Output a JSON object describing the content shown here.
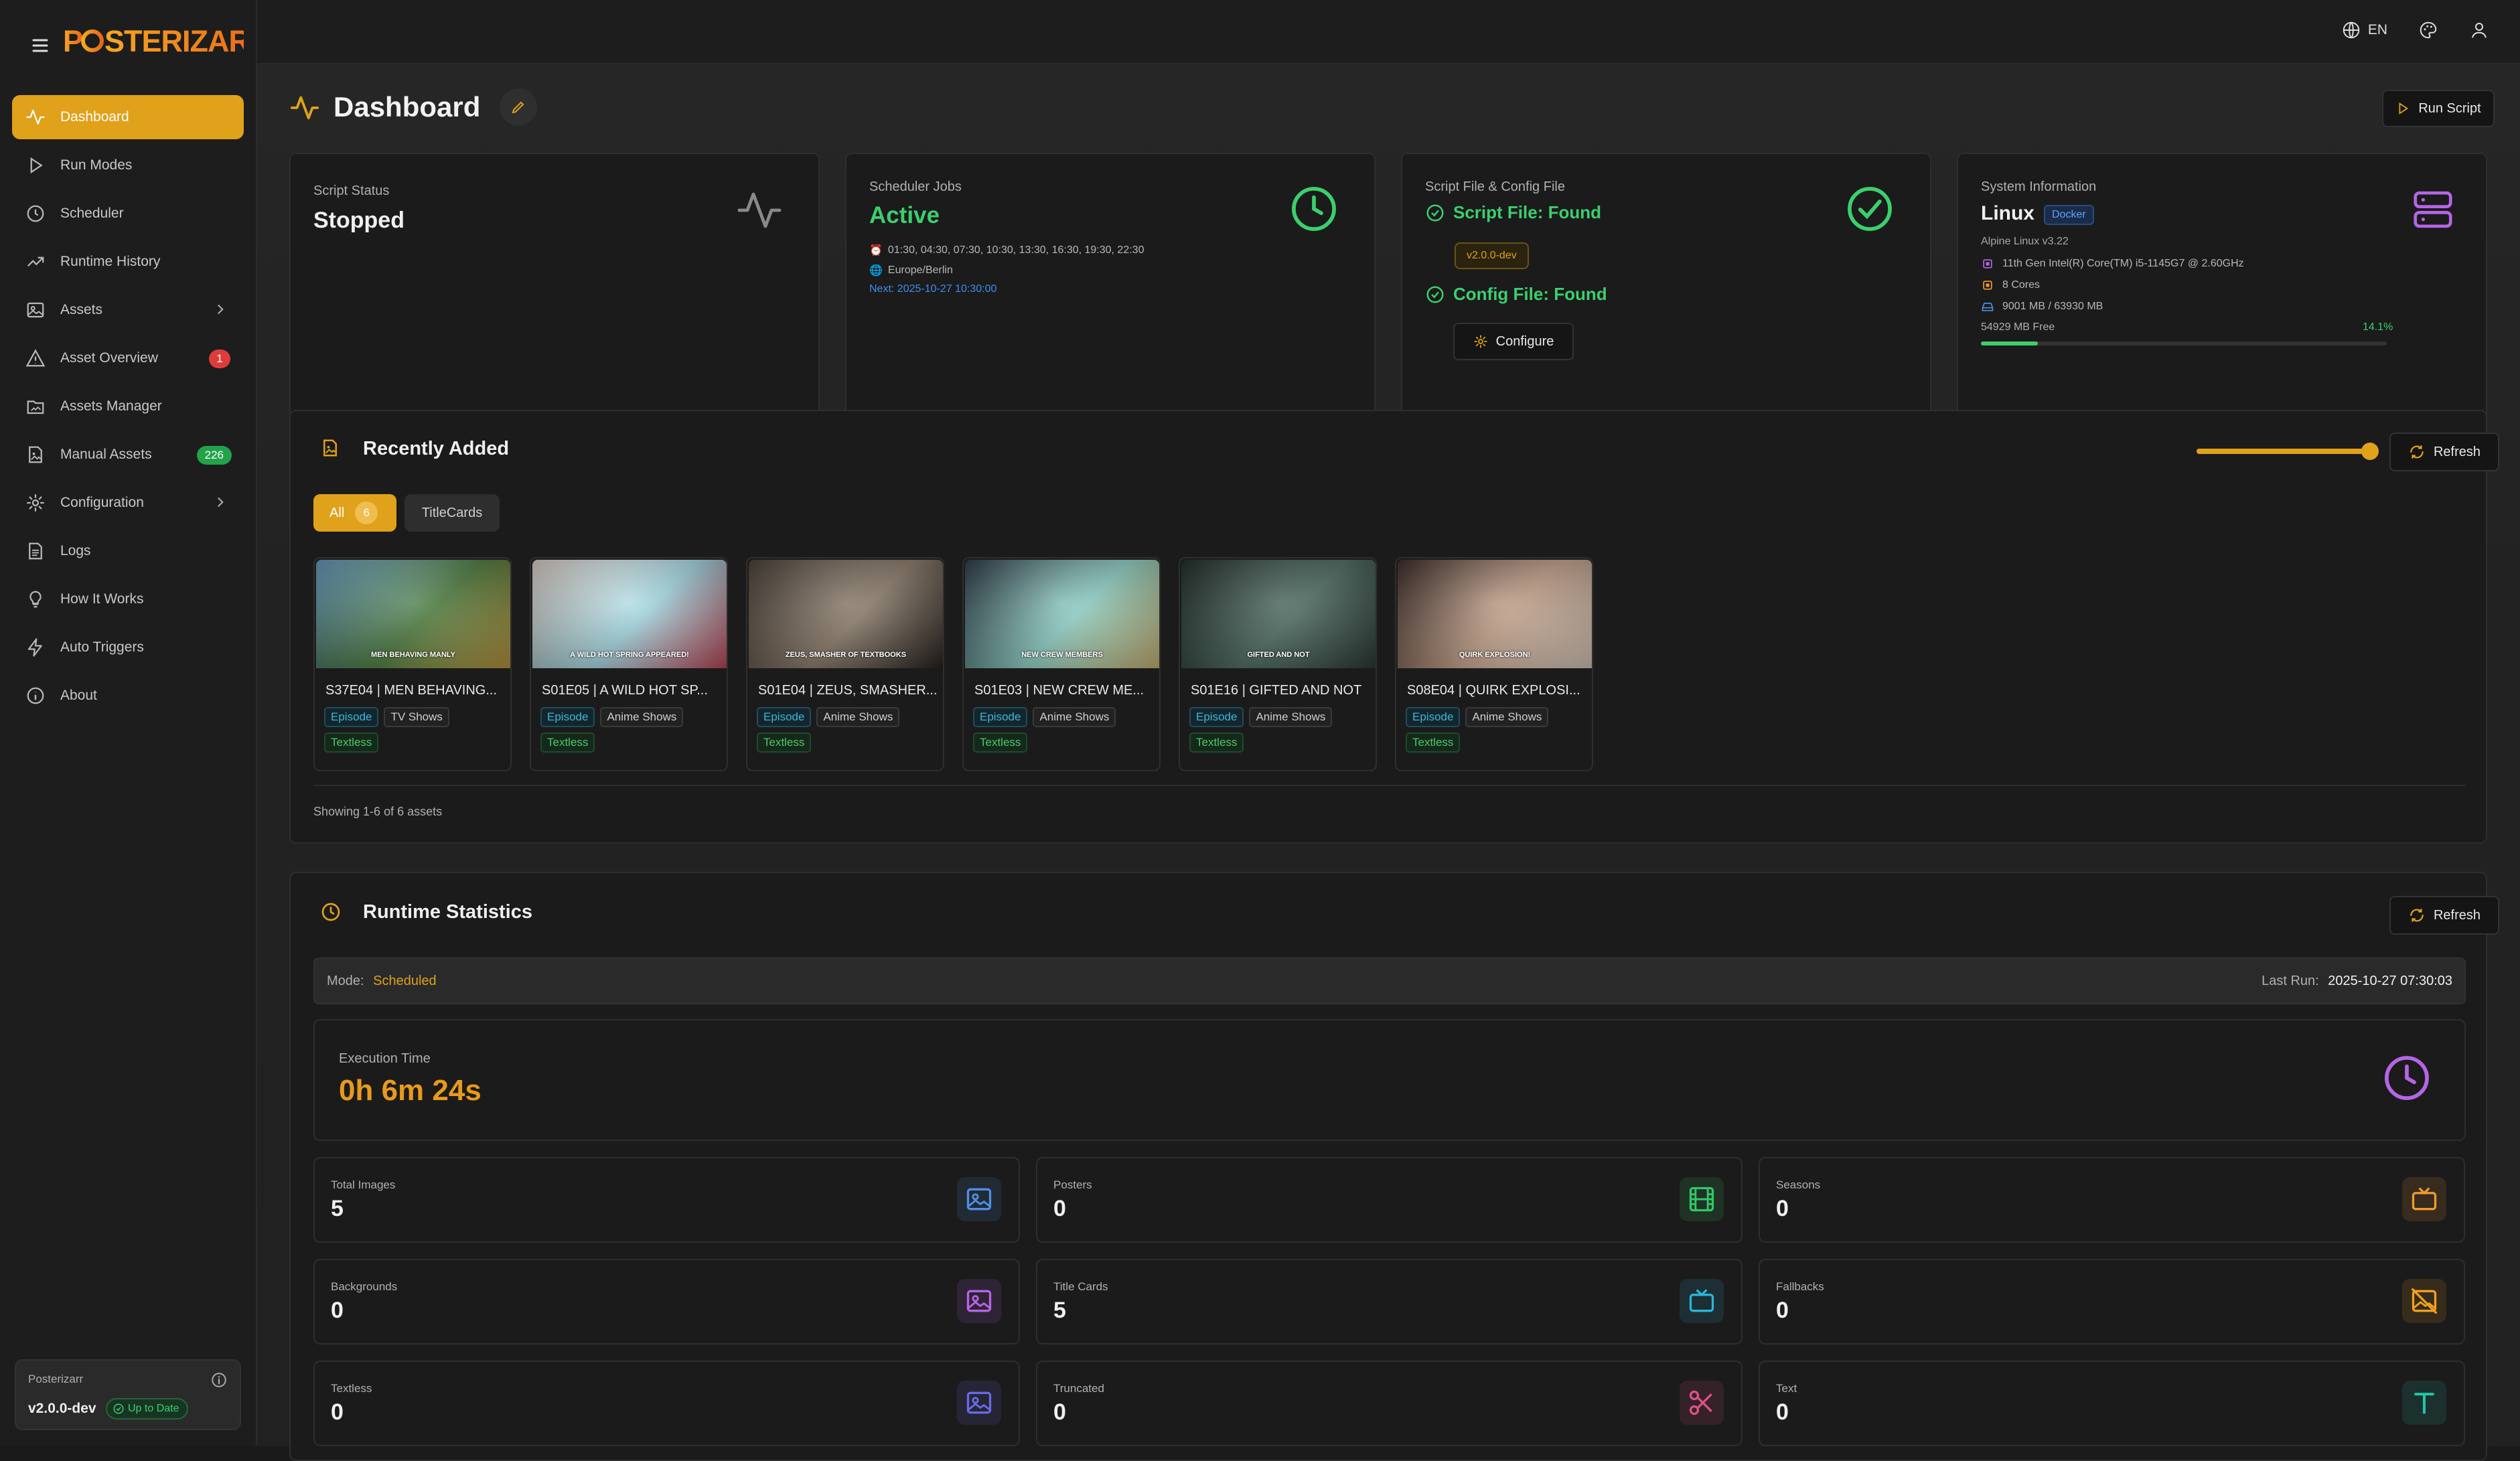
{
  "app": {
    "logo_text": "POSTERIZARR"
  },
  "topbar": {
    "lang": "EN"
  },
  "sidebar": {
    "items": [
      {
        "label": "Dashboard",
        "icon": "activity-icon",
        "active": true
      },
      {
        "label": "Run Modes",
        "icon": "play-icon"
      },
      {
        "label": "Scheduler",
        "icon": "clock-icon"
      },
      {
        "label": "Runtime History",
        "icon": "trending-up-icon"
      },
      {
        "label": "Assets",
        "icon": "image-icon",
        "chevron": true
      },
      {
        "label": "Asset Overview",
        "icon": "alert-triangle-icon",
        "badge": "1"
      },
      {
        "label": "Assets Manager",
        "icon": "folder-icon"
      },
      {
        "label": "Manual Assets",
        "icon": "file-image-icon",
        "badge": "226"
      },
      {
        "label": "Configuration",
        "icon": "gear-icon",
        "chevron": true
      },
      {
        "label": "Logs",
        "icon": "file-text-icon"
      },
      {
        "label": "How It Works",
        "icon": "lightbulb-icon"
      },
      {
        "label": "Auto Triggers",
        "icon": "zap-icon"
      },
      {
        "label": "About",
        "icon": "info-icon"
      }
    ],
    "version_box": {
      "app_name": "Posterizarr",
      "version": "v2.0.0-dev",
      "status": "Up to Date"
    }
  },
  "header": {
    "title": "Dashboard",
    "run_button": "Run Script"
  },
  "cards": {
    "script_status": {
      "label": "Script Status",
      "value": "Stopped"
    },
    "scheduler": {
      "label": "Scheduler Jobs",
      "value": "Active",
      "times": "01:30, 04:30, 07:30, 10:30, 13:30, 16:30, 19:30, 22:30",
      "timezone": "Europe/Berlin",
      "next": "Next: 2025-10-27 10:30:00"
    },
    "files": {
      "label": "Script File & Config File",
      "script_file": "Script File: Found",
      "version": "v2.0.0-dev",
      "config_file": "Config File: Found",
      "configure_button": "Configure"
    },
    "system": {
      "label": "System Information",
      "os": "Linux",
      "badge": "Docker",
      "distro": "Alpine Linux v3.22",
      "cpu": "11th Gen Intel(R) Core(TM) i5-1145G7 @ 2.60GHz",
      "cores": "8 Cores",
      "memory": "9001 MB / 63930 MB",
      "free": "54929 MB Free",
      "mem_percent_label": "14.1%",
      "mem_fraction": 0.141
    }
  },
  "recent": {
    "title": "Recently Added",
    "refresh": "Refresh",
    "tabs": {
      "all": "All",
      "all_count": "6",
      "titlecards": "TitleCards"
    },
    "footer": "Showing 1-6 of 6 assets",
    "items": [
      {
        "title": "S37E04 | MEN BEHAVING...",
        "caption": "MEN BEHAVING MANLY",
        "tag1": "Episode",
        "tag2": "TV Shows",
        "tag3": "Textless",
        "colors": [
          "#6aa0c9",
          "#4a7a3a",
          "#c7a142"
        ]
      },
      {
        "title": "S01E05 | A WILD HOT SP...",
        "caption": "A WILD HOT SPRING APPEARED!",
        "tag1": "Episode",
        "tag2": "Anime Shows",
        "tag3": "Textless",
        "colors": [
          "#e8d9d0",
          "#a5dbe6",
          "#c94b5b"
        ]
      },
      {
        "title": "S01E04 | ZEUS, SMASHER...",
        "caption": "ZEUS, SMASHER OF TEXTBOOKS",
        "tag1": "Episode",
        "tag2": "Anime Shows",
        "tag3": "Textless",
        "colors": [
          "#4a4038",
          "#8a7a68",
          "#2a2420"
        ]
      },
      {
        "title": "S01E03 | NEW CREW ME...",
        "caption": "NEW CREW MEMBERS",
        "tag1": "Episode",
        "tag2": "Anime Shows",
        "tag3": "Textless",
        "colors": [
          "#2c3a46",
          "#8fd3c8",
          "#d8c07a"
        ]
      },
      {
        "title": "S01E16 | GIFTED AND NOT",
        "caption": "GIFTED AND NOT",
        "tag1": "Episode",
        "tag2": "Anime Shows",
        "tag3": "Textless",
        "colors": [
          "#1e2a26",
          "#4a6a5e",
          "#2e3e38"
        ]
      },
      {
        "title": "S08E04 | QUIRK EXPLOSI...",
        "caption": "QUIRK EXPLOSION!",
        "tag1": "Episode",
        "tag2": "Anime Shows",
        "tag3": "Textless",
        "colors": [
          "#3a2a26",
          "#c7a38a",
          "#e8d8c8"
        ]
      }
    ]
  },
  "runtime": {
    "title": "Runtime Statistics",
    "refresh": "Refresh",
    "mode_label": "Mode:",
    "mode": "Scheduled",
    "last_run_label": "Last Run:",
    "last_run": "2025-10-27 07:30:03",
    "exec_label": "Execution Time",
    "exec_value": "0h 6m 24s",
    "stats": [
      {
        "label": "Total Images",
        "value": "5",
        "icon": "image-icon",
        "color": "#4f8fe6"
      },
      {
        "label": "Posters",
        "value": "0",
        "icon": "film-icon",
        "color": "#32c766"
      },
      {
        "label": "Seasons",
        "value": "0",
        "icon": "tv-icon",
        "color": "#f29a2e"
      },
      {
        "label": "Backgrounds",
        "value": "0",
        "icon": "image-icon",
        "color": "#b565e6"
      },
      {
        "label": "Title Cards",
        "value": "5",
        "icon": "tv-icon",
        "color": "#2ab6d8"
      },
      {
        "label": "Fallbacks",
        "value": "0",
        "icon": "image-off-icon",
        "color": "#f0a020"
      },
      {
        "label": "Textless",
        "value": "0",
        "icon": "image-icon",
        "color": "#6a6ae8"
      },
      {
        "label": "Truncated",
        "value": "0",
        "icon": "scissors-icon",
        "color": "#e0508a"
      },
      {
        "label": "Text",
        "value": "0",
        "icon": "type-icon",
        "color": "#22c5a8"
      }
    ]
  },
  "colors": {
    "accent": "#e0a11b",
    "active_green": "#3ccf6e",
    "link_blue": "#3f8df0"
  }
}
